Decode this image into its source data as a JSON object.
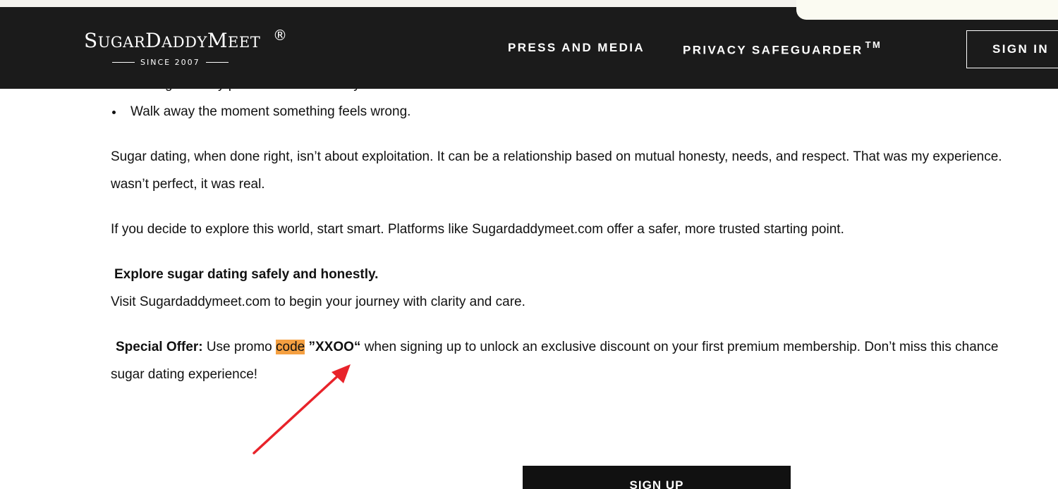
{
  "header": {
    "logo": {
      "wordmark": "SugarDaddyMeet",
      "registered_mark": "®",
      "tagline": "SINCE 2007"
    },
    "nav": {
      "press_label": "PRESS AND MEDIA",
      "privacy_label": "PRIVACY SAFEGUARDER",
      "privacy_tm": "TM",
      "signin_label": "SIGN IN"
    }
  },
  "article": {
    "bullets": [
      "Don't give away personal details easily.",
      "Walk away the moment something feels wrong."
    ],
    "para1_line1": "Sugar dating, when done right, isn’t about exploitation. It can be a relationship based on mutual honesty, needs, and respect. That was my experience.",
    "para1_line2": "wasn’t perfect, it was real.",
    "para2": "If you decide to explore this world, start smart. Platforms like Sugardaddymeet.com offer a safer, more trusted starting point.",
    "cta_heading": "Explore sugar dating safely and honestly.",
    "cta_text": "Visit Sugardaddymeet.com to begin your journey with clarity and care.",
    "offer": {
      "label": "Special Offer:",
      "text_before": " Use promo ",
      "highlight": "code",
      "code": " ”XXOO“",
      "text_after": " when signing up to unlock an exclusive discount on your first premium membership. Don’t miss this chance",
      "line2": "sugar dating experience!"
    }
  },
  "signup_label": "SIGN UP",
  "colors": {
    "header_bg": "#1b1b1b",
    "highlight": "#f5a041",
    "annotation_arrow": "#e8232a"
  }
}
